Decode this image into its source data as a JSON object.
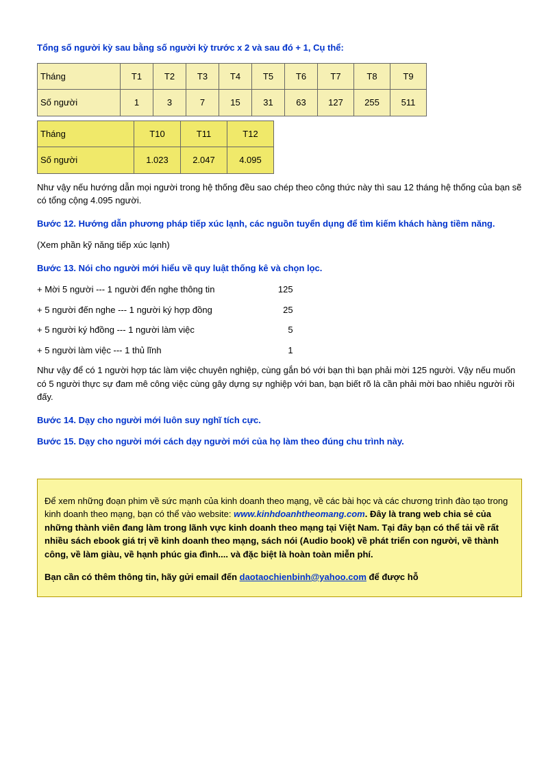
{
  "title": "Tổng số người kỳ sau bằng số người kỳ trước x 2 và sau đó + 1, Cụ thể:",
  "table1": {
    "row1label": "Tháng",
    "row1": [
      "T1",
      "T2",
      "T3",
      "T4",
      "T5",
      "T6",
      "T7",
      "T8",
      "T9"
    ],
    "row2label": "Số người",
    "row2": [
      "1",
      "3",
      "7",
      "15",
      "31",
      "63",
      "127",
      "255",
      "511"
    ]
  },
  "table2": {
    "row1label": "Tháng",
    "row1": [
      "T10",
      "T11",
      "T12"
    ],
    "row2label": "Số người",
    "row2": [
      "1.023",
      "2.047",
      "4.095"
    ]
  },
  "para1": "Như vậy nếu hướng dẫn mọi người trong hệ thống đều sao chép theo công thức này thì sau 12 tháng hệ thống của bạn sẽ có tổng cộng 4.095 người.",
  "step12": "Bước 12. Hướng dẫn phương pháp tiếp xúc lạnh, các nguồn tuyển dụng để tìm kiếm khách hàng tiềm năng.",
  "step12note": "(Xem phần kỹ năng tiếp xúc lạnh)",
  "step13": "Bước 13. Nói cho người mới hiểu về quy luật thống kê và chọn lọc.",
  "stats": [
    {
      "left": "+ Mời 5 người --- 1 người đến nghe thông tin",
      "right": "125"
    },
    {
      "left": "+ 5 người đến nghe --- 1 người ký hợp đồng",
      "right": "25"
    },
    {
      "left": "+ 5 người ký hđồng --- 1 người làm việc",
      "right": "5"
    },
    {
      "left": "+ 5 người làm việc --- 1 thủ lĩnh",
      "right": "1"
    }
  ],
  "para2": "Như vậy để có 1 người hợp tác làm việc chuyên nghiệp, cùng gắn bó với bạn thì bạn phải mời 125 người. Vậy nếu muốn có 5 người thực sự đam mê công việc cùng gây dựng sự nghiệp với ban, bạn biết rõ là cần phải mời bao nhiêu người rồi đấy.",
  "step14": "Bước 14. Dạy cho người mới luôn suy nghĩ tích cực.",
  "step15": "Bước 15. Dạy cho người mới cách dạy người mới của họ làm theo đúng chu trình này.",
  "info": {
    "p1a": "Để xem những đoạn phim về sức mạnh của kinh doanh theo mạng, về các bài học và các chương trình đào tạo trong kinh doanh theo mạng, bạn có thể vào website: ",
    "link1": "www.kinhdoanhtheomang.com",
    "p1b": ". Đây là trang web chia sẻ của những thành viên đang làm trong lãnh vực kinh doanh theo mạng tại Việt Nam. Tại đây bạn có thể tải về rất nhiều sách ebook giá trị về kinh doanh theo mạng, sách nói (Audio book) về phát triển con người, về thành công, về làm giàu, về hạnh phúc gia đình.... và đặc biệt là hoàn toàn miễn phí.",
    "p2a": "Bạn cần có thêm thông tin, hãy gửi email đến ",
    "link2": "daotaochienbinh@yahoo.com",
    "p2b": " để được hỗ"
  }
}
